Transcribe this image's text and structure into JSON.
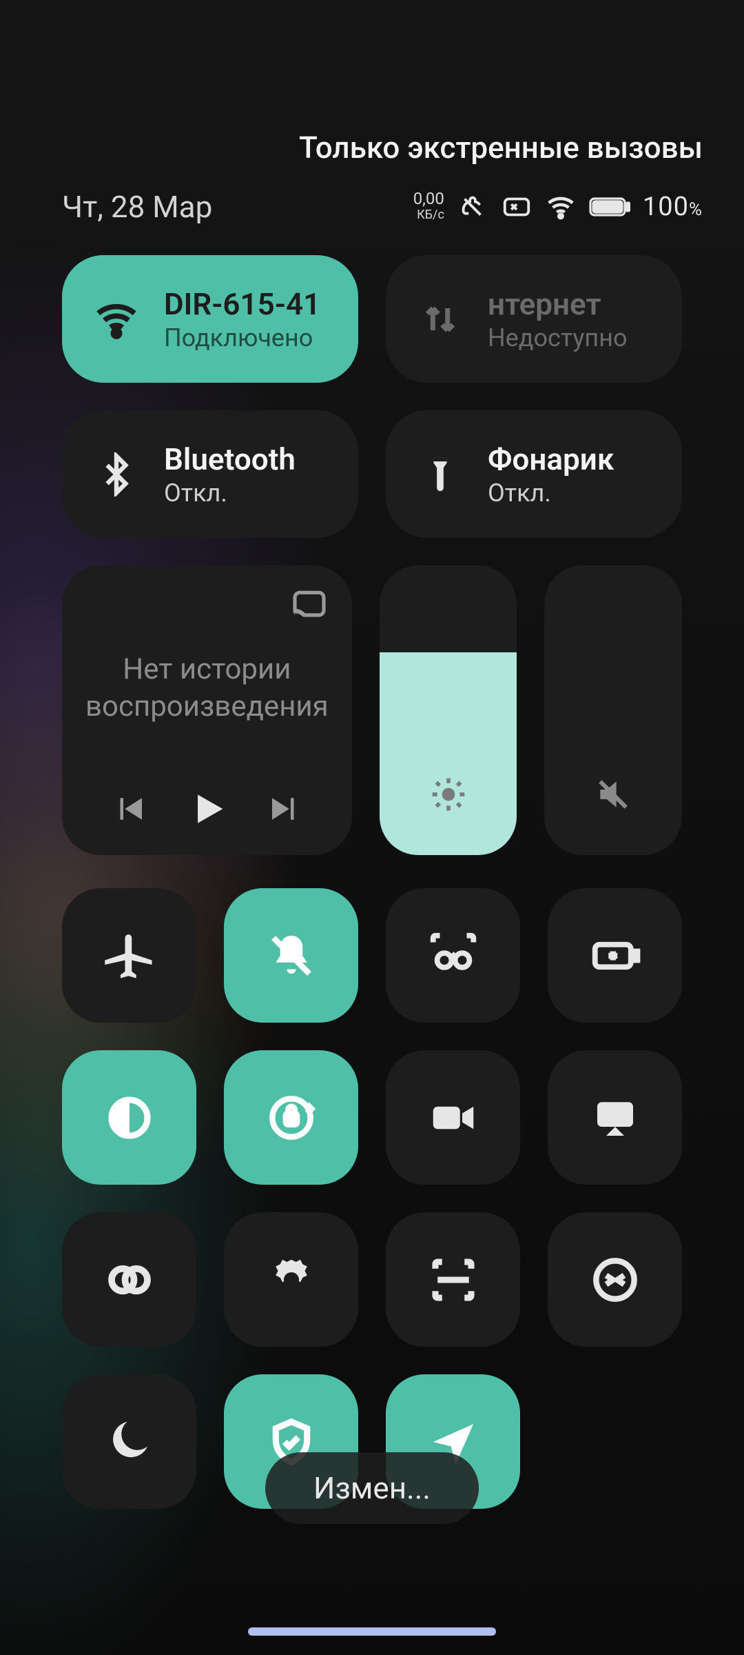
{
  "emergency_text": "Только экстренные вызовы",
  "date": "Чт, 28 Мар",
  "status": {
    "data_rate": "0,00",
    "data_unit": "КБ/с",
    "battery": "100"
  },
  "wifi_tile": {
    "title": "DIR-615-41",
    "sub": "Подключено"
  },
  "data_tile": {
    "title": "нтернет",
    "sub": "Недоступно"
  },
  "bt_tile": {
    "title": "Bluetooth",
    "sub": "Откл."
  },
  "flash_tile": {
    "title": "Фонарик",
    "sub": "Откл."
  },
  "media": {
    "line1": "Нет истории",
    "line2": "воспроизведения"
  },
  "brightness_pct": 70,
  "volume_pct": 0,
  "edit_label": "Измен..."
}
